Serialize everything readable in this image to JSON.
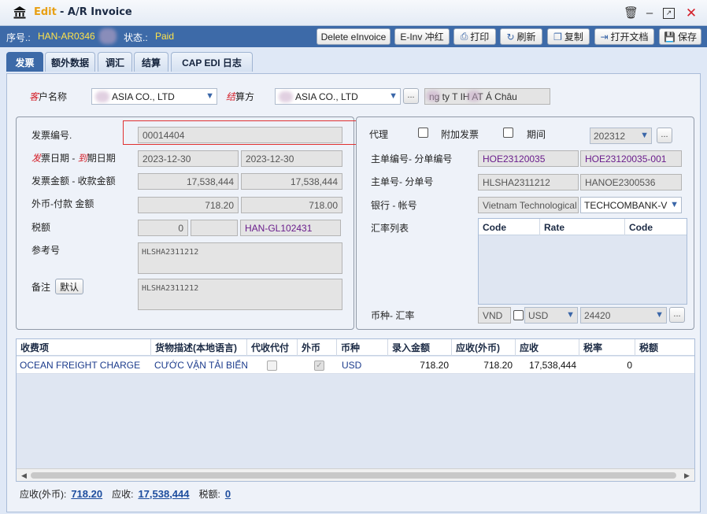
{
  "window": {
    "app": "Edit",
    "sep": "- A/R Invoice"
  },
  "info": {
    "seq_label": "序号.:",
    "seq_value": "HAN-AR0346",
    "status_label": "状态.:",
    "status_value": "Paid"
  },
  "toolbar": {
    "delete_einvoice": "Delete eInvoice",
    "einv_red": "E-Inv 冲红",
    "print": "打印",
    "refresh": "刷新",
    "copy": "复制",
    "open_doc": "打开文档",
    "save": "保存"
  },
  "tabs": [
    "发票",
    "额外数据",
    "调汇",
    "结算",
    "CAP EDI 日志"
  ],
  "customer": {
    "label_a": "客",
    "label_b": "户名称",
    "value": "ASIA CO., LTD",
    "settle_a": "结",
    "settle_b": "算方",
    "settle_value": "ASIA CO., LTD",
    "party_value": "ng ty T    IH AT Á Châu",
    "more": "..."
  },
  "left": {
    "invoice_no_label": "发票编号.",
    "invoice_no": "00014404",
    "date_a": "发",
    "date_b": "票日期 - ",
    "date_c": "到",
    "date_d": "期日期",
    "invoice_date": "2023-12-30",
    "due_date": "2023-12-30",
    "amount_label": "发票金额 - 收款金额",
    "invoice_amount": "17,538,444",
    "received_amount": "17,538,444",
    "fx_label": "外币-付款 金额",
    "fx_amount": "718.20",
    "fx_paid": "718.00",
    "tax_label": "税额",
    "tax_value": "0",
    "tax_extra": "",
    "tax_ref": "HAN-GL102431",
    "ref_label": "参考号",
    "ref_value": "HLSHA2311212",
    "remark_label": "备注",
    "default_btn": "默认",
    "remark_value": "HLSHA2311212"
  },
  "right": {
    "agent_label": "代理",
    "addl_invoice_label": "附加发票",
    "period_label": "期间",
    "period_value": "202312",
    "mbl_label": "主单编号- 分单编号",
    "mbl_no": "HOE23120035",
    "hbl_no": "HOE23120035-001",
    "master_label": "主单号- 分单号",
    "master_no": "HLSHA2311212",
    "house_no": "HANOE2300536",
    "bank_label": "银行 - 帐号",
    "bank_name": "Vietnam Technological",
    "bank_account": "TECHCOMBANK-V",
    "rate_list_label": "汇率列表",
    "rate_cols": [
      "Code",
      "Rate",
      "Code"
    ],
    "currency_label": "币种- 汇率",
    "currency_local": "VND",
    "currency_fx": "USD",
    "rate_value": "24420"
  },
  "charges": {
    "columns": [
      "收费项",
      "货物描述(本地语言)",
      "代收代付",
      "外币",
      "币种",
      "录入金额",
      "应收(外币)",
      "应收",
      "税率",
      "税额"
    ],
    "rows": [
      {
        "item": "OCEAN FREIGHT CHARGE",
        "desc": "CƯỚC VẬN TẢI BIỂN",
        "currency": "USD",
        "entered": "718.20",
        "ar_fx": "718.20",
        "ar": "17,538,444",
        "tax_rate": "0",
        "tax": ""
      }
    ]
  },
  "footer": {
    "ar_fx_label": "应收(外币):",
    "ar_fx_value": "718.20",
    "ar_label": "应收:",
    "ar_value": "17,538,444",
    "tax_label": "税额:",
    "tax_value": "0"
  },
  "colors": {
    "accent": "#3d6aa8",
    "status": "#ffe34a",
    "highlight_box": "#e03030"
  }
}
